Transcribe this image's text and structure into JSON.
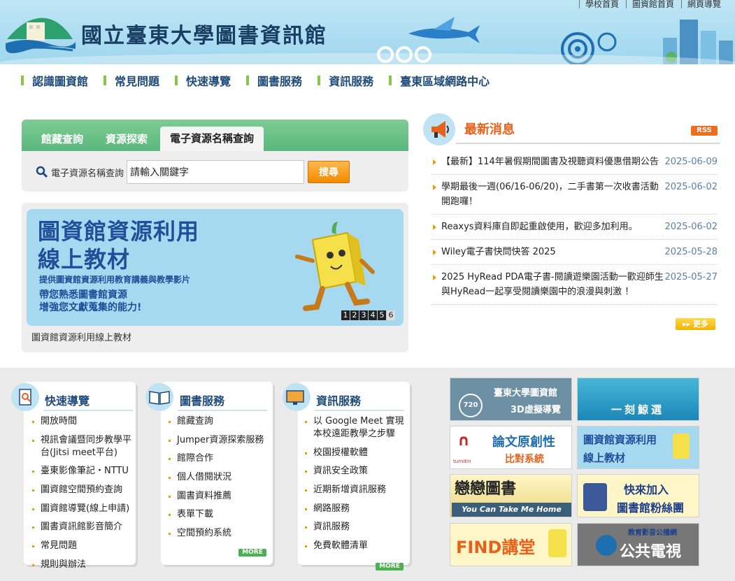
{
  "header": {
    "site_title": "國立臺東大學圖書資訊館",
    "top_links": [
      "學校首頁",
      "圖資館首頁",
      "網頁導覽"
    ]
  },
  "nav": [
    "認識圖資館",
    "常見問題",
    "快速導覽",
    "圖書服務",
    "資訊服務",
    "臺東區域網路中心"
  ],
  "search": {
    "tabs": [
      "館藏查詢",
      "資源探索",
      "電子資源名稱查詢"
    ],
    "active_tab": "電子資源名稱查詢",
    "label": "電子資源名稱查詢",
    "value": "請輸入關鍵字",
    "button": "搜尋"
  },
  "banner": {
    "title_line1": "圖資館資源利用",
    "title_line2": "線上教材",
    "sub1": "提供圖資館資源利用教育講義與教學影片",
    "sub2_line1": "帶您熟悉圖書館資源",
    "sub2_line2": "增強您文獻蒐集的能力!",
    "pages": [
      "1",
      "2",
      "3",
      "4",
      "5",
      "6"
    ],
    "current_page": "6",
    "caption": "圖資館資源利用線上教材"
  },
  "news": {
    "title": "最新消息",
    "rss": "RSS",
    "items": [
      {
        "text": "【最新】114年暑假期間圖書及視聽資料優惠借期公告",
        "date": "2025-06-09"
      },
      {
        "text": "學期最後一週(06/16-06/20)，二手書第一次收書活動開跑囉！",
        "date": "2025-06-02"
      },
      {
        "text": "Reaxys資料庫自即起重啟使用，歡迎多加利用。",
        "date": "2025-06-02"
      },
      {
        "text": "Wiley電子書快問快答 2025",
        "date": "2025-05-28"
      },
      {
        "text": "2025 HyRead PDA電子書-閱讀遊樂園活動一歡迎師生與HyRead一起享受閱讀樂園中的浪漫與刺激 ！",
        "date": "2025-05-27"
      }
    ],
    "more": "更多"
  },
  "cards": {
    "quick": {
      "title": "快速導覽",
      "items": [
        "開放時間",
        "視訊會議暨同步教學平台(Jitsi meet平台)",
        "臺東影像筆記・NTTU",
        "圖資館空間預約查詢",
        "圖資館導覽(線上申請)",
        "圖書資訊館影音簡介",
        "常見問題",
        "規則與辦法"
      ]
    },
    "books": {
      "title": "圖書服務",
      "items": [
        "館藏查詢",
        "Jumper資源探索服務",
        "館際合作",
        "個人借閱狀況",
        "圖書資料推薦",
        "表單下載",
        "空間預約系統"
      ],
      "more": "MORE"
    },
    "info": {
      "title": "資訊服務",
      "items": [
        "以 Google Meet 實現本校遠距教學之步驟",
        "校園授權軟體",
        "資訊安全政策",
        "近期新增資訊服務",
        "網路服務",
        "資訊服務",
        "免費軟體清單"
      ],
      "more": "MORE"
    }
  },
  "tiles": {
    "t1_line1": "臺東大學圖資館",
    "t1_line2": "3D虛擬導覽",
    "t1_badge": "720",
    "t2": "一刻鯨選",
    "t3_line1": "論文原創性",
    "t3_line2": "比對系統",
    "t3_logo": "turnitin",
    "t4_line1": "圖資館資源利用",
    "t4_line2": "線上教材",
    "t5_line1": "戀戀圖書",
    "t5_line2": "You Can Take Me Home",
    "t6_line1": "快來加入",
    "t6_line2": "圖書館粉絲團",
    "t7": "FIND講堂",
    "t8_line1": "教育影音公播網",
    "t8_line2": "公共電視"
  },
  "colors": {
    "nav_text": "#1e4a7a",
    "accent_green": "#8bc34a",
    "news_orange": "#e8611a",
    "tab_green": "#5bb87c"
  }
}
